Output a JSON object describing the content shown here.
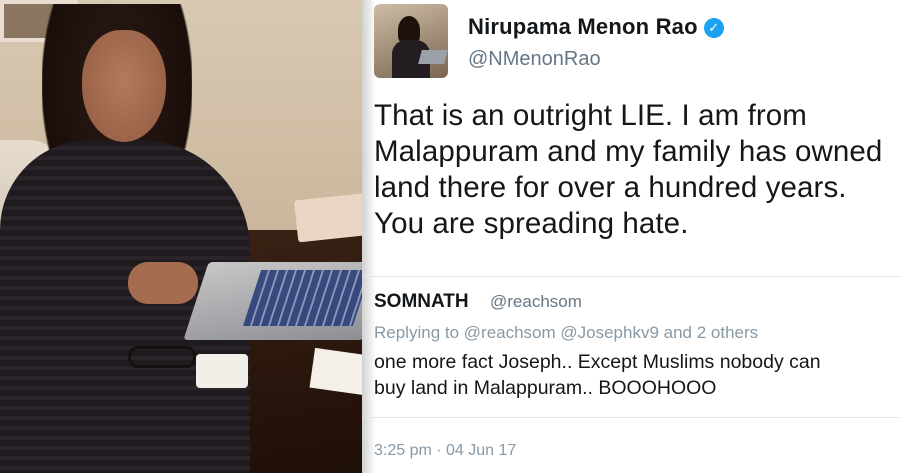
{
  "tweet": {
    "author_name": "Nirupama Menon Rao",
    "verified_icon": "verified-badge-icon",
    "author_handle": "@NMenonRao",
    "text": "That is an outright LIE. I am from Malappuram and my family has owned land there for over a hundred years. You are spreading hate.",
    "timestamp": "3:25 pm · 04 Jun 17"
  },
  "quoted_tweet": {
    "author_name": "SOMNATH",
    "author_handle": "@reachsom",
    "replying_to": "Replying to @reachsom @Josephkv9 and 2 others",
    "text": "one more fact Joseph.. Except Muslims nobody can\nbuy land in Malappuram.. BOOOHOOO"
  },
  "colors": {
    "verified": "#1da1f2",
    "handle_gray": "#657786",
    "text_dark": "#14171a"
  }
}
